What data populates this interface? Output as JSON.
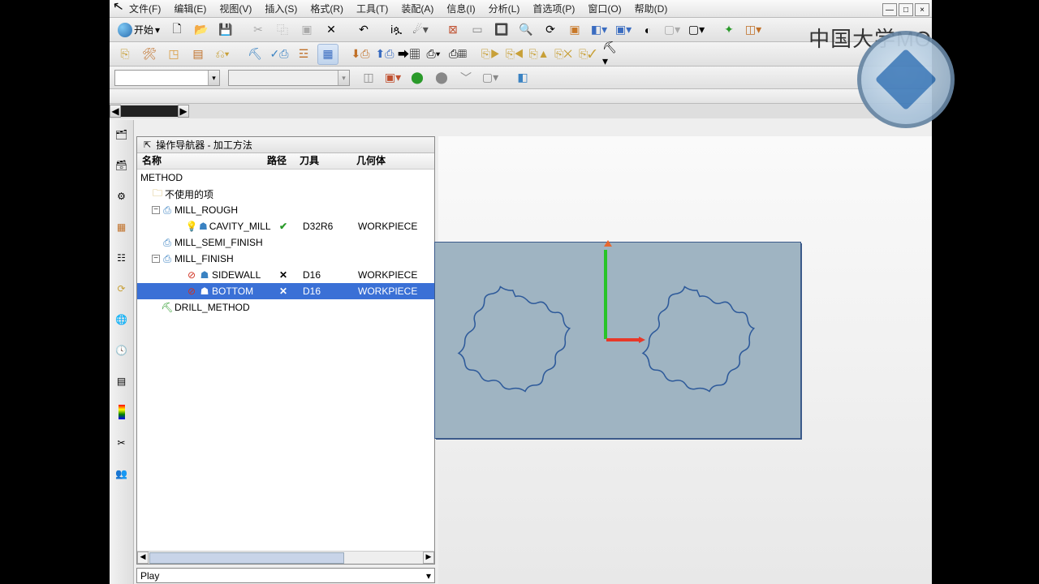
{
  "menu": {
    "file": "文件(F)",
    "edit": "编辑(E)",
    "view": "视图(V)",
    "insert": "插入(S)",
    "format": "格式(R)",
    "tools": "工具(T)",
    "assembly": "装配(A)",
    "info": "信息(I)",
    "analysis": "分析(L)",
    "prefs": "首选项(P)",
    "window": "窗口(O)",
    "help": "帮助(D)"
  },
  "start": {
    "label": "开始 "
  },
  "combo2": {
    "text": ""
  },
  "navigator": {
    "title": "操作导航器 - 加工方法",
    "cols": {
      "name": "名称",
      "path": "路径",
      "tool": "刀具",
      "geom": "几何体"
    },
    "root": "METHOD",
    "unused": "不使用的项",
    "rough": "MILL_ROUGH",
    "cavity": {
      "name": "CAVITY_MILL",
      "tool": "D32R6",
      "geom": "WORKPIECE"
    },
    "semi": "MILL_SEMI_FINISH",
    "finish": "MILL_FINISH",
    "sidewall": {
      "name": "SIDEWALL",
      "tool": "D16",
      "geom": "WORKPIECE"
    },
    "bottom": {
      "name": "BOTTOM",
      "tool": "D16",
      "geom": "WORKPIECE"
    },
    "drill": "DRILL_METHOD"
  },
  "play": {
    "label": "Play"
  },
  "brand": {
    "text": "中国大学MO"
  }
}
